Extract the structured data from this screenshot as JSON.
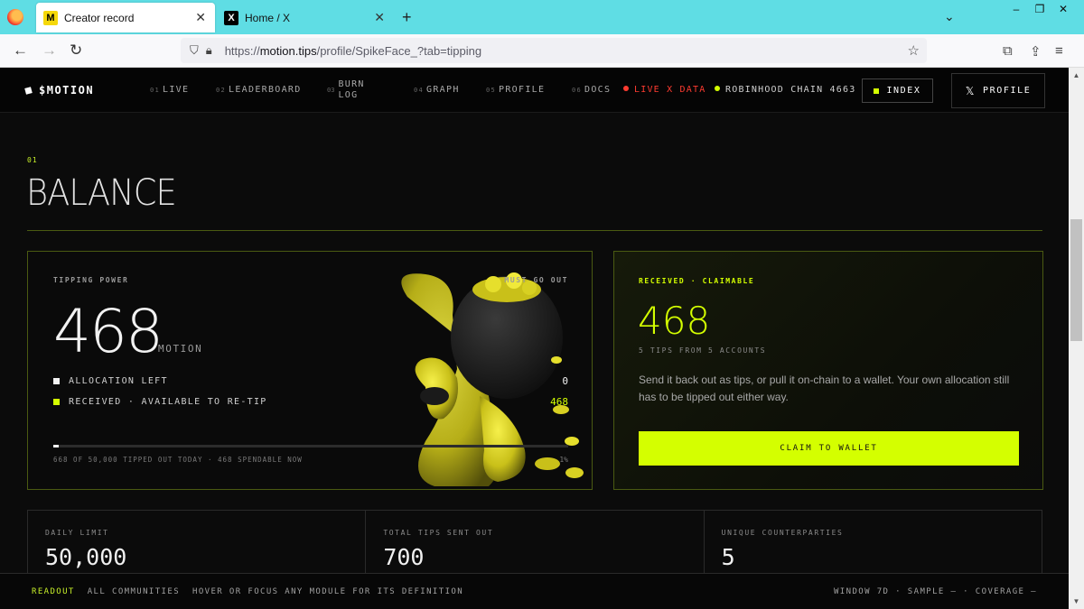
{
  "browser": {
    "tabs": [
      {
        "title": "Creator record",
        "favicon": "M",
        "active": true
      },
      {
        "title": "Home / X",
        "favicon": "X",
        "active": false
      }
    ],
    "url_prefix": "https://",
    "url_domain": "motion.tips",
    "url_path": "/profile/SpikeFace_?tab=tipping"
  },
  "header": {
    "brand": "$MOTION",
    "nav": [
      {
        "num": "01",
        "label": "LIVE"
      },
      {
        "num": "02",
        "label": "LEADERBOARD"
      },
      {
        "num": "03",
        "label_line1": "BURN",
        "label_line2": "LOG"
      },
      {
        "num": "04",
        "label": "GRAPH"
      },
      {
        "num": "05",
        "label": "PROFILE"
      },
      {
        "num": "06",
        "label": "DOCS"
      }
    ],
    "live_x": "LIVE X DATA",
    "chain": "ROBINHOOD CHAIN 4663",
    "index_btn": "INDEX",
    "profile_btn": "PROFILE"
  },
  "section": {
    "num": "01",
    "title": "BALANCE"
  },
  "tipping": {
    "label": "TIPPING POWER",
    "tag": "MUST GO OUT",
    "value": "468",
    "unit": "MOTION",
    "rows": [
      {
        "label": "ALLOCATION LEFT",
        "value": "0",
        "color": "#f2f2f2"
      },
      {
        "label": "RECEIVED · AVAILABLE TO RE-TIP",
        "value": "468",
        "color": "#d4ff00"
      }
    ],
    "progress_fraction": 0.01,
    "progress_caption": "668 OF 50,000 TIPPED OUT TODAY · 468 SPENDABLE NOW",
    "progress_pct": "1%"
  },
  "received": {
    "label": "RECEIVED · CLAIMABLE",
    "value": "468",
    "sub": "5 TIPS FROM 5 ACCOUNTS",
    "desc": "Send it back out as tips, or pull it on-chain to a wallet. Your own allocation still has to be tipped out either way.",
    "button": "CLAIM TO WALLET"
  },
  "stats": [
    {
      "label": "DAILY LIMIT",
      "value": "50,000"
    },
    {
      "label": "TOTAL TIPS SENT OUT",
      "value": "700"
    },
    {
      "label": "UNIQUE COUNTERPARTIES",
      "value": "5"
    }
  ],
  "readout": {
    "tag": "READOUT",
    "scope": "ALL COMMUNITIES",
    "hint": "HOVER OR FOCUS ANY MODULE FOR ITS DEFINITION",
    "right": "WINDOW 7D · SAMPLE — · COVERAGE —"
  },
  "colors": {
    "accent": "#d4ff00",
    "live": "#ff3b30"
  }
}
